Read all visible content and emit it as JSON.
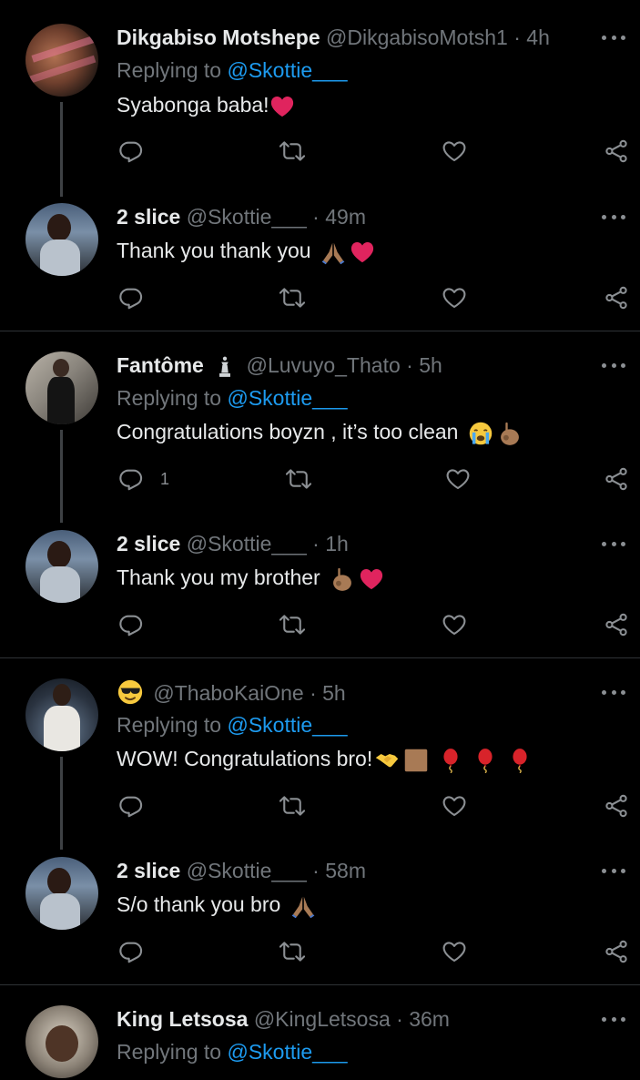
{
  "thread1": {
    "reply": {
      "name": "Dikgabiso Motshepe",
      "handle": "@DikgabisoMotsh1",
      "time": "4h",
      "replying_label": "Replying to",
      "replying_to": "@Skottie___",
      "text": "Syabonga baba!"
    },
    "response": {
      "name": "2 slice",
      "handle": "@Skottie___",
      "time": "49m",
      "text": "Thank you thank you"
    }
  },
  "thread2": {
    "reply": {
      "name": "Fantôme",
      "handle": "@Luvuyo_Thato",
      "time": "5h",
      "replying_label": "Replying to",
      "replying_to": "@Skottie___",
      "text": "Congratulations boyzn , it’s too clean",
      "reply_count": "1"
    },
    "response": {
      "name": "2 slice",
      "handle": "@Skottie___",
      "time": "1h",
      "text": "Thank you my brother"
    }
  },
  "thread3": {
    "reply": {
      "handle": "@ThaboKaiOne",
      "time": "5h",
      "replying_label": "Replying to",
      "replying_to": "@Skottie___",
      "text": "WOW! Congratulations bro!"
    },
    "response": {
      "name": "2 slice",
      "handle": "@Skottie___",
      "time": "58m",
      "text": "S/o thank you bro"
    }
  },
  "thread4": {
    "reply": {
      "name": "King Letsosa",
      "handle": "@KingLetsosa",
      "time": "36m",
      "replying_label": "Replying to",
      "replying_to": "@Skottie___"
    }
  },
  "colors": {
    "background": "#000000",
    "mention": "#1d9bf0",
    "secondary": "#71767b",
    "heart": "#e0245e"
  }
}
